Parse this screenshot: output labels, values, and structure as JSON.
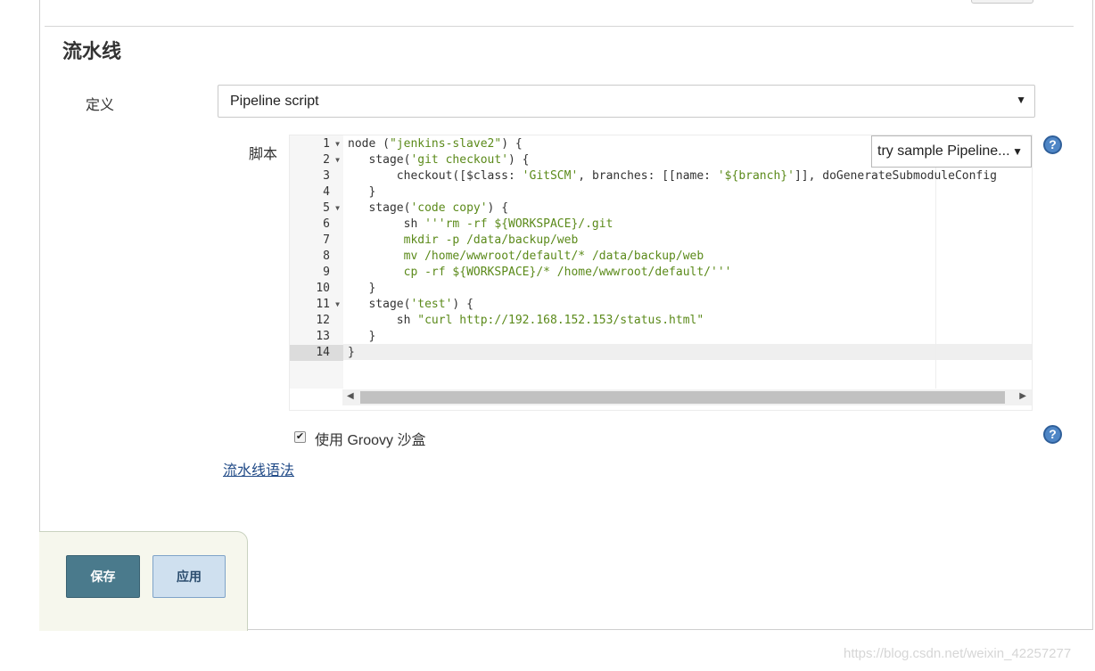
{
  "section_title": "流水线",
  "definition": {
    "label": "定义",
    "selected": "Pipeline script"
  },
  "script": {
    "label": "脚本",
    "sample_select": "try sample Pipeline...",
    "line_numbers": [
      "1",
      "2",
      "3",
      "4",
      "5",
      "6",
      "7",
      "8",
      "9",
      "10",
      "11",
      "12",
      "13",
      "14"
    ],
    "lines": [
      "node (\"jenkins-slave2\") {",
      "   stage('git checkout') {",
      "       checkout([$class: 'GitSCM', branches: [[name: '${branch}']], doGenerateSubmoduleConfig",
      "   }",
      "   stage('code copy') {",
      "        sh '''rm -rf ${WORKSPACE}/.git",
      "        mkdir -p /data/backup/web",
      "        mv /home/wwwroot/default/* /data/backup/web",
      "        cp -rf ${WORKSPACE}/* /home/wwwroot/default/'''",
      "   }",
      "   stage('test') {",
      "       sh \"curl http://192.168.152.153/status.html\"",
      "   }",
      "}"
    ],
    "fold_lines": [
      1,
      2,
      5,
      11
    ],
    "active_line": 14
  },
  "groovy_sandbox": {
    "label": "使用 Groovy 沙盒",
    "checked": true
  },
  "syntax_link": "流水线语法",
  "buttons": {
    "save": "保存",
    "apply": "应用"
  },
  "help_glyph": "?",
  "watermark": "https://blog.csdn.net/weixin_42257277"
}
